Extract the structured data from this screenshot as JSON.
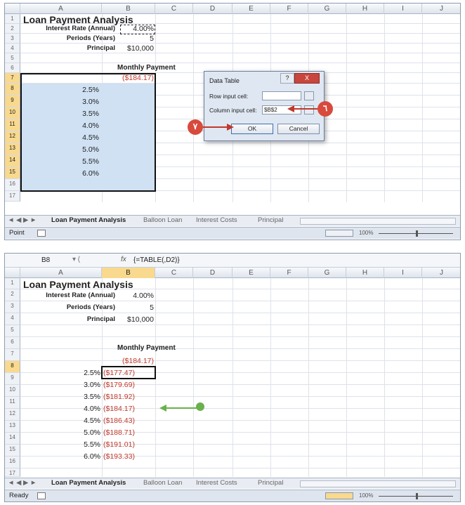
{
  "columns": [
    "A",
    "B",
    "C",
    "D",
    "E",
    "F",
    "G",
    "H",
    "I",
    "J"
  ],
  "rows": [
    "1",
    "2",
    "3",
    "4",
    "5",
    "6",
    "7",
    "8",
    "9",
    "10",
    "11",
    "12",
    "13",
    "14",
    "15",
    "16",
    "17"
  ],
  "top": {
    "title": "Loan Payment Analysis",
    "labels": {
      "rate": "Interest Rate (Annual)",
      "periods": "Periods (Years)",
      "principal": "Principal"
    },
    "values": {
      "rate": "4.00%",
      "periods": "5",
      "principal": "$10,000"
    },
    "header": "Monthly Payment",
    "b7": "($184.17)",
    "rates": [
      "2.5%",
      "3.0%",
      "3.5%",
      "4.0%",
      "4.5%",
      "5.0%",
      "5.5%",
      "6.0%"
    ],
    "dialog": {
      "title": "Data Table",
      "help": "?",
      "close": "X",
      "row_label": "Row input cell:",
      "row_value": "",
      "col_label": "Column input cell:",
      "col_value": "$B$2",
      "ok": "OK",
      "cancel": "Cancel"
    },
    "badges": {
      "six": "٦",
      "seven": "٧"
    },
    "tabs": [
      "Loan Payment Analysis",
      "Balloon Loan",
      "Interest Costs",
      "Principal"
    ],
    "status": "Point",
    "zoom": "100%"
  },
  "bottom": {
    "namebox": "B8",
    "fx": "fx",
    "formula": "{=TABLE(,D2)}",
    "title": "Loan Payment Analysis",
    "labels": {
      "rate": "Interest Rate (Annual)",
      "periods": "Periods (Years)",
      "principal": "Principal"
    },
    "values": {
      "rate": "4.00%",
      "periods": "5",
      "principal": "$10,000"
    },
    "header": "Monthly Payment",
    "b7": "($184.17)",
    "rates": [
      "2.5%",
      "3.0%",
      "3.5%",
      "4.0%",
      "4.5%",
      "5.0%",
      "5.5%",
      "6.0%"
    ],
    "payments": [
      "($177.47)",
      "($179.69)",
      "($181.92)",
      "($184.17)",
      "($186.43)",
      "($188.71)",
      "($191.01)",
      "($193.33)"
    ],
    "tabs": [
      "Loan Payment Analysis",
      "Balloon Loan",
      "Interest Costs",
      "Principal"
    ],
    "status": "Ready",
    "zoom": "100%"
  }
}
